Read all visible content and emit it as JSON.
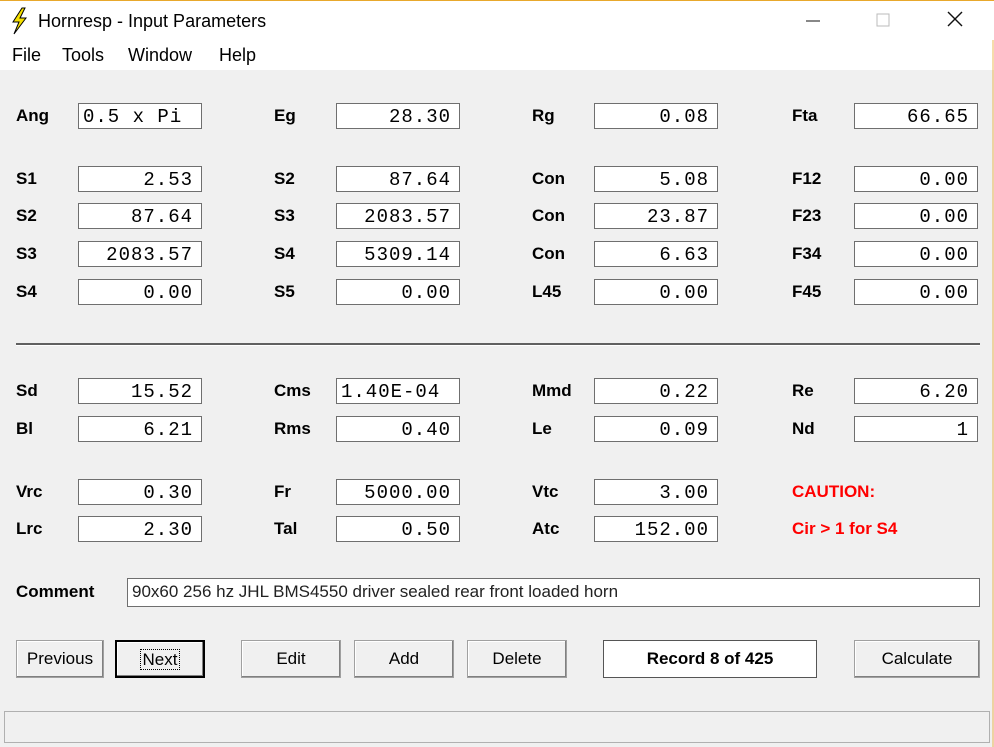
{
  "window": {
    "title": "Hornresp - Input Parameters"
  },
  "menu": [
    "File",
    "Tools",
    "Window",
    "Help"
  ],
  "fields": {
    "ang": {
      "label": "Ang",
      "value": "0.5 x Pi"
    },
    "eg": {
      "label": "Eg",
      "value": "28.30"
    },
    "rg": {
      "label": "Rg",
      "value": "0.08"
    },
    "fta": {
      "label": "Fta",
      "value": "66.65"
    },
    "r1_s1": {
      "label": "S1",
      "value": "2.53"
    },
    "r1_s2": {
      "label": "S2",
      "value": "87.64"
    },
    "r1_con": {
      "label": "Con",
      "value": "5.08"
    },
    "r1_f12": {
      "label": "F12",
      "value": "0.00"
    },
    "r2_s2": {
      "label": "S2",
      "value": "87.64"
    },
    "r2_s3": {
      "label": "S3",
      "value": "2083.57"
    },
    "r2_con": {
      "label": "Con",
      "value": "23.87"
    },
    "r2_f23": {
      "label": "F23",
      "value": "0.00"
    },
    "r3_s3": {
      "label": "S3",
      "value": "2083.57"
    },
    "r3_s4": {
      "label": "S4",
      "value": "5309.14"
    },
    "r3_con": {
      "label": "Con",
      "value": "6.63"
    },
    "r3_f34": {
      "label": "F34",
      "value": "0.00"
    },
    "r4_s4": {
      "label": "S4",
      "value": "0.00"
    },
    "r4_s5": {
      "label": "S5",
      "value": "0.00"
    },
    "r4_l45": {
      "label": "L45",
      "value": "0.00"
    },
    "r4_f45": {
      "label": "F45",
      "value": "0.00"
    },
    "sd": {
      "label": "Sd",
      "value": "15.52"
    },
    "cms": {
      "label": "Cms",
      "value": "1.40E-04"
    },
    "mmd": {
      "label": "Mmd",
      "value": "0.22"
    },
    "re": {
      "label": "Re",
      "value": "6.20"
    },
    "bl": {
      "label": "Bl",
      "value": "6.21"
    },
    "rms": {
      "label": "Rms",
      "value": "0.40"
    },
    "le": {
      "label": "Le",
      "value": "0.09"
    },
    "nd": {
      "label": "Nd",
      "value": "1"
    },
    "vrc": {
      "label": "Vrc",
      "value": "0.30"
    },
    "fr": {
      "label": "Fr",
      "value": "5000.00"
    },
    "vtc": {
      "label": "Vtc",
      "value": "3.00"
    },
    "lrc": {
      "label": "Lrc",
      "value": "2.30"
    },
    "tal": {
      "label": "Tal",
      "value": "0.50"
    },
    "atc": {
      "label": "Atc",
      "value": "152.00"
    }
  },
  "caution": {
    "title": "CAUTION:",
    "message": "Cir > 1 for S4"
  },
  "comment": {
    "label": "Comment",
    "value": "90x60 256 hz  JHL BMS4550 driver sealed rear  front loaded horn"
  },
  "buttons": {
    "previous": "Previous",
    "next": "Next",
    "edit": "Edit",
    "add": "Add",
    "delete": "Delete",
    "calculate": "Calculate"
  },
  "record": "Record 8 of 425",
  "colors": {
    "caution": "#ff0000",
    "window_border": "#e8a82c"
  }
}
